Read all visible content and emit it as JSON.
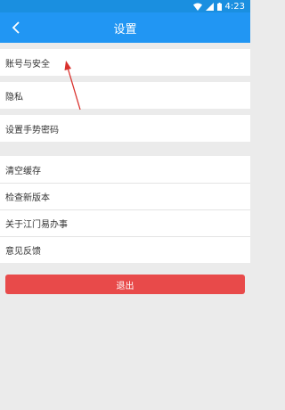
{
  "status_bar": {
    "time": "4:23",
    "icons": [
      "wifi-icon",
      "signal-icon",
      "battery-icon"
    ]
  },
  "app_bar": {
    "title": "设置",
    "back_icon": "chevron-left-icon"
  },
  "groups": [
    {
      "items": [
        {
          "label": "账号与安全"
        }
      ]
    },
    {
      "items": [
        {
          "label": "隐私"
        }
      ]
    },
    {
      "items": [
        {
          "label": "设置手势密码"
        }
      ]
    },
    {
      "items": [
        {
          "label": "清空缓存"
        },
        {
          "label": "检查新版本"
        },
        {
          "label": "关于江门易办事"
        },
        {
          "label": "意见反馈"
        }
      ]
    }
  ],
  "logout_button": {
    "label": "退出"
  },
  "colors": {
    "primary": "#2196f3",
    "status_bar": "#1a8fe0",
    "logout": "#e84a4a",
    "annotation": "#d9302c",
    "background": "#ebebeb"
  }
}
